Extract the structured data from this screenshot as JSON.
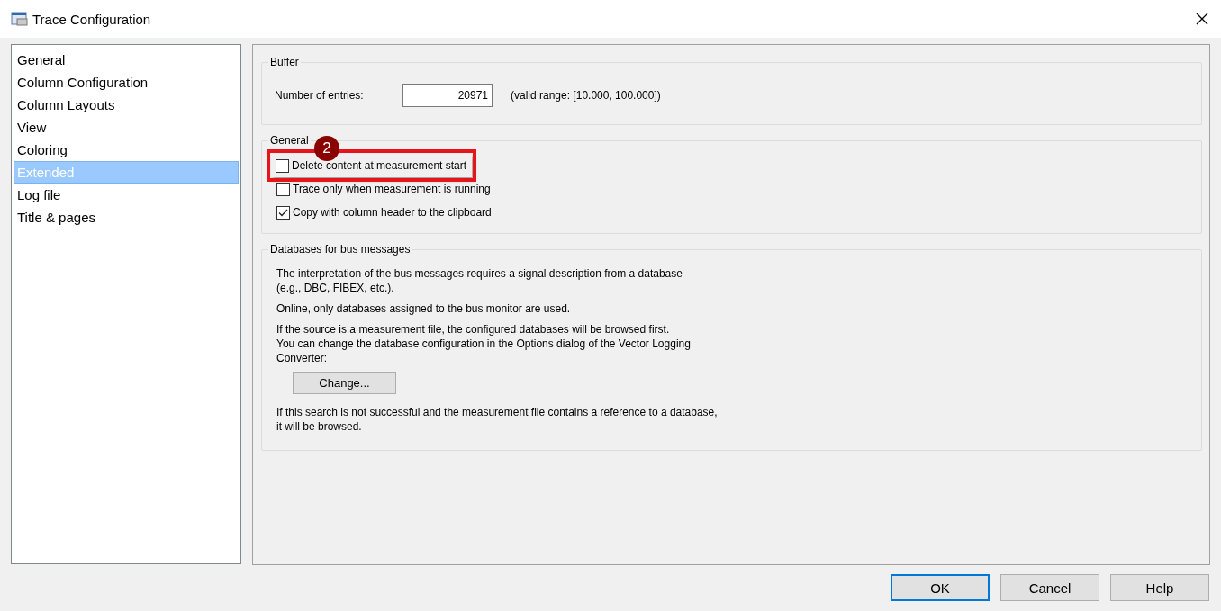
{
  "window": {
    "title": "Trace Configuration"
  },
  "sidebar": {
    "items": [
      {
        "label": "General",
        "selected": false
      },
      {
        "label": "Column Configuration",
        "selected": false
      },
      {
        "label": "Column Layouts",
        "selected": false
      },
      {
        "label": "View",
        "selected": false
      },
      {
        "label": "Coloring",
        "selected": false
      },
      {
        "label": "Extended",
        "selected": true
      },
      {
        "label": "Log file",
        "selected": false
      },
      {
        "label": "Title & pages",
        "selected": false
      }
    ]
  },
  "buffer": {
    "title": "Buffer",
    "label": "Number of entries:",
    "value": "20971",
    "hint": "(valid range: [10.000, 100.000])"
  },
  "general": {
    "title": "General",
    "badge": "2",
    "options": [
      {
        "label": "Delete content at measurement start",
        "checked": false,
        "highlighted": true
      },
      {
        "label": "Trace only when measurement is running",
        "checked": false,
        "highlighted": false
      },
      {
        "label": "Copy with column header to the clipboard",
        "checked": true,
        "highlighted": false
      }
    ]
  },
  "databases": {
    "title": "Databases for bus messages",
    "paragraphs": [
      "The interpretation of the bus messages requires a signal description from a database\n(e.g., DBC, FIBEX, etc.).",
      "Online, only databases assigned to the bus monitor are used.",
      "If the source is a measurement file, the configured databases will be browsed first.\nYou can change the database configuration in the Options dialog of the Vector Logging\nConverter:"
    ],
    "button": "Change...",
    "footer": "If this search is not successful and the measurement file contains a reference to a database,\nit will be browsed."
  },
  "buttons": [
    {
      "label": "OK",
      "focused": true
    },
    {
      "label": "Cancel",
      "focused": false
    },
    {
      "label": "Help",
      "focused": false
    }
  ]
}
